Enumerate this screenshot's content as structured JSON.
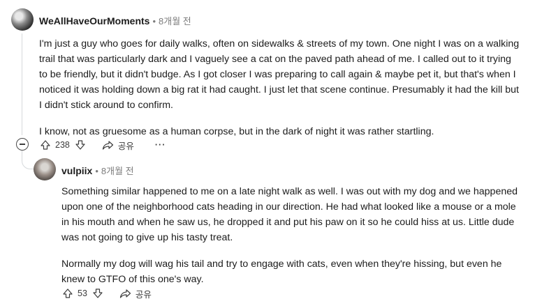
{
  "comment1": {
    "author": "WeAllHaveOurMoments",
    "time": "8개월 전",
    "paragraphs": [
      "I'm just a guy who goes for daily walks, often on sidewalks & streets of my town. One night I was on a walking trail that was particularly dark and I vaguely see a cat on the paved path ahead of me. I called out to it trying to be friendly, but it didn't budge. As I got closer I was preparing to call again & maybe pet it, but that's when I noticed it was holding down a big rat it had caught. I just let that scene continue. Presumably it had the kill but I didn't stick around to confirm.",
      "I know, not as gruesome as a human corpse, but in the dark of night it was rather startling."
    ],
    "votes": "238",
    "share_label": "공유",
    "more_label": "···"
  },
  "comment2": {
    "author": "vulpiix",
    "time": "8개월 전",
    "paragraphs": [
      "Something similar happened to me on a late night walk as well. I was out with my dog and we happened upon one of the neighborhood cats heading in our direction. He had what looked like a mouse or a mole in his mouth and when he saw us, he dropped it and put his paw on it so he could hiss at us. Little dude was not going to give up his tasty treat.",
      "Normally my dog will wag his tail and try to engage with cats, even when they're hissing, but even he knew to GTFO of this one's way."
    ],
    "votes": "53",
    "share_label": "공유"
  }
}
